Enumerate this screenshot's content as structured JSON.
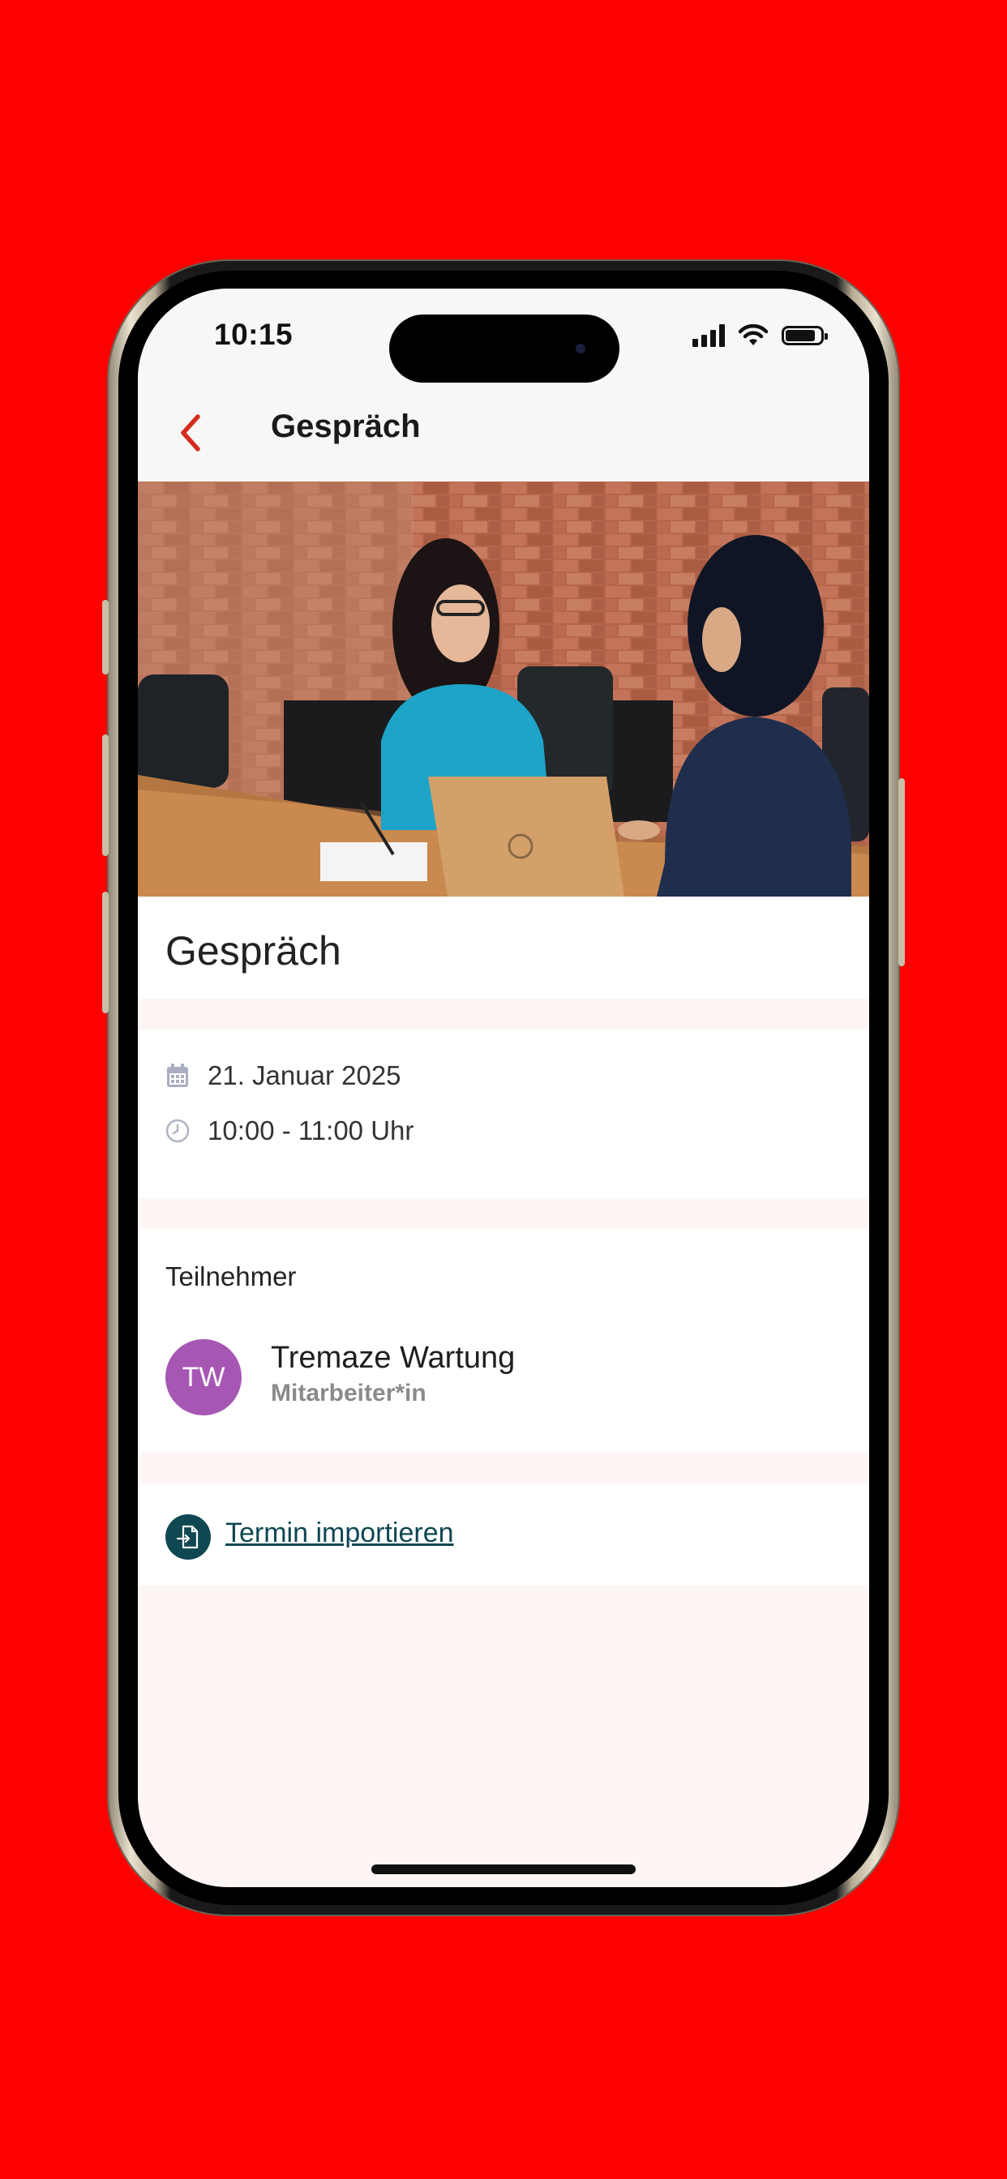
{
  "status_bar": {
    "time": "10:15"
  },
  "header": {
    "title": "Gespräch"
  },
  "event": {
    "title": "Gespräch",
    "date": "21. Januar 2025",
    "time_range": "10:00 - 11:00 Uhr"
  },
  "participants": {
    "label": "Teilnehmer",
    "items": [
      {
        "initials": "TW",
        "name": "Tremaze Wartung",
        "role": "Mitarbeiter*in",
        "avatar_color": "#a657b4"
      }
    ]
  },
  "actions": {
    "import_label": "Termin importieren"
  },
  "colors": {
    "background": "#ff0000",
    "accent_red": "#d52b1e",
    "link_teal": "#0f4752"
  },
  "icons": [
    "chevron-left-icon",
    "calendar-icon",
    "clock-icon",
    "calendar-import-icon",
    "signal-icon",
    "wifi-icon",
    "battery-icon"
  ]
}
